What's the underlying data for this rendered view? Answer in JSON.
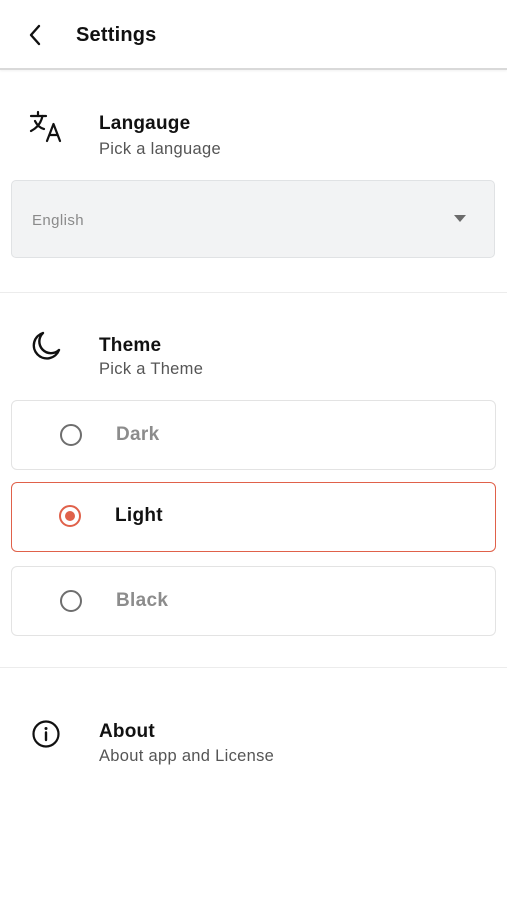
{
  "appbar": {
    "title": "Settings",
    "back_icon": "chevron-left-icon"
  },
  "language": {
    "icon": "translate-icon",
    "title": "Langauge",
    "subtitle": "Pick a language",
    "selected": "English"
  },
  "theme": {
    "icon": "moon-icon",
    "title": "Theme",
    "subtitle": "Pick a Theme",
    "options": [
      {
        "label": "Dark",
        "selected": false
      },
      {
        "label": "Light",
        "selected": true
      },
      {
        "label": "Black",
        "selected": false
      }
    ]
  },
  "about": {
    "icon": "info-icon",
    "title": "About",
    "subtitle": "About app and License"
  },
  "colors": {
    "accent": "#e0614a",
    "select_bg": "#f2f3f4",
    "muted_text": "#8c8c8c"
  }
}
